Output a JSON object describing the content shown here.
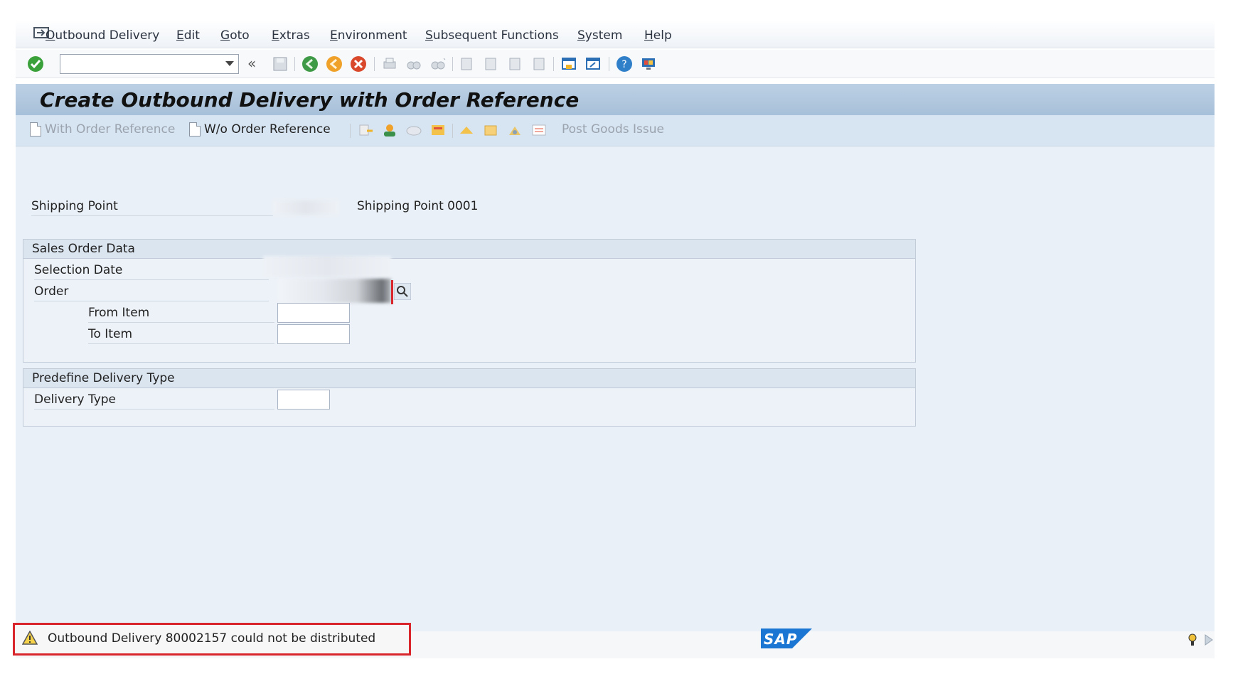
{
  "menubar": {
    "items": [
      "Outbound Delivery",
      "Edit",
      "Goto",
      "Extras",
      "Environment",
      "Subsequent Functions",
      "System",
      "Help"
    ]
  },
  "toolbar": {
    "command_field_value": "",
    "icons": [
      "enter-icon",
      "back-icon",
      "save-icon",
      "back-green-icon",
      "exit-icon",
      "cancel-icon",
      "print-icon",
      "find-icon",
      "find-next-icon",
      "first-page-icon",
      "previous-page-icon",
      "next-page-icon",
      "last-page-icon",
      "create-session-icon",
      "shortcut-icon",
      "help-icon",
      "customize-layout-icon"
    ]
  },
  "screen": {
    "title": "Create Outbound Delivery with Order Reference"
  },
  "app_toolbar": {
    "with_order_ref": "With Order Reference",
    "wo_order_ref": "W/o Order Reference",
    "post_goods_issue": "Post Goods Issue"
  },
  "form": {
    "shipping_point_label": "Shipping Point",
    "shipping_point_desc": "Shipping Point 0001",
    "sales_order_group": "Sales Order Data",
    "selection_date_label": "Selection Date",
    "order_label": "Order",
    "from_item_label": "From Item",
    "to_item_label": "To Item",
    "from_item_value": "",
    "to_item_value": "",
    "predefine_group": "Predefine Delivery Type",
    "delivery_type_label": "Delivery Type",
    "delivery_type_value": ""
  },
  "status": {
    "message": "Outbound Delivery 80002157 could not be distributed",
    "type": "warning"
  },
  "branding": {
    "logo_text": "SAP"
  },
  "colors": {
    "title_bar": "#a7c0d9",
    "main_bg": "#eaf0f7",
    "status_highlight": "#d9262c",
    "sap_blue": "#1a76d2"
  }
}
